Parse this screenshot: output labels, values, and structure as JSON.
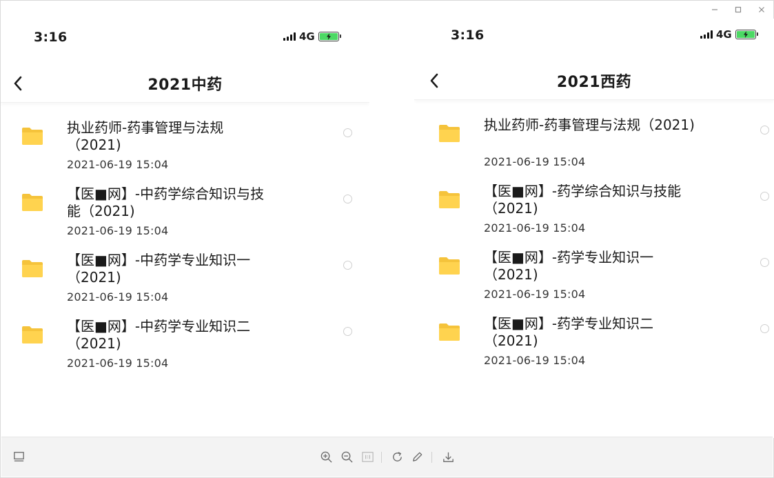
{
  "left_phone": {
    "status": {
      "time": "3:16",
      "network": "4G"
    },
    "title": "2021中药",
    "items": [
      {
        "name": "执业药师-药事管理与法规（2021)",
        "date": "2021-06-19 15:04"
      },
      {
        "name": "【医■网】-中药学综合知识与技能（2021)",
        "date": "2021-06-19 15:04"
      },
      {
        "name": "【医■网】-中药学专业知识一（2021)",
        "date": "2021-06-19 15:04"
      },
      {
        "name": "【医■网】-中药学专业知识二（2021)",
        "date": "2021-06-19 15:04"
      }
    ]
  },
  "right_phone": {
    "status": {
      "time": "3:16",
      "network": "4G"
    },
    "title": "2021西药",
    "items": [
      {
        "name": "执业药师-药事管理与法规（2021)",
        "date": "2021-06-19 15:04"
      },
      {
        "name": "【医■网】-药学综合知识与技能（2021)",
        "date": "2021-06-19 15:04"
      },
      {
        "name": "【医■网】-药学专业知识一（2021)",
        "date": "2021-06-19 15:04"
      },
      {
        "name": "【医■网】-药学专业知识二（2021)",
        "date": "2021-06-19 15:04"
      }
    ]
  },
  "colors": {
    "folder": "#ffd34f",
    "folder_dark": "#f5c33b",
    "battery": "#4cd964",
    "toolbar_bg": "#f3f3f3"
  },
  "icons": {
    "window_controls": [
      "minimize-icon",
      "maximize-icon",
      "close-icon"
    ],
    "toolbar": [
      "thumbnail-icon",
      "zoom-in-icon",
      "zoom-out-icon",
      "actual-size-icon",
      "rotate-icon",
      "edit-icon",
      "download-icon"
    ]
  }
}
